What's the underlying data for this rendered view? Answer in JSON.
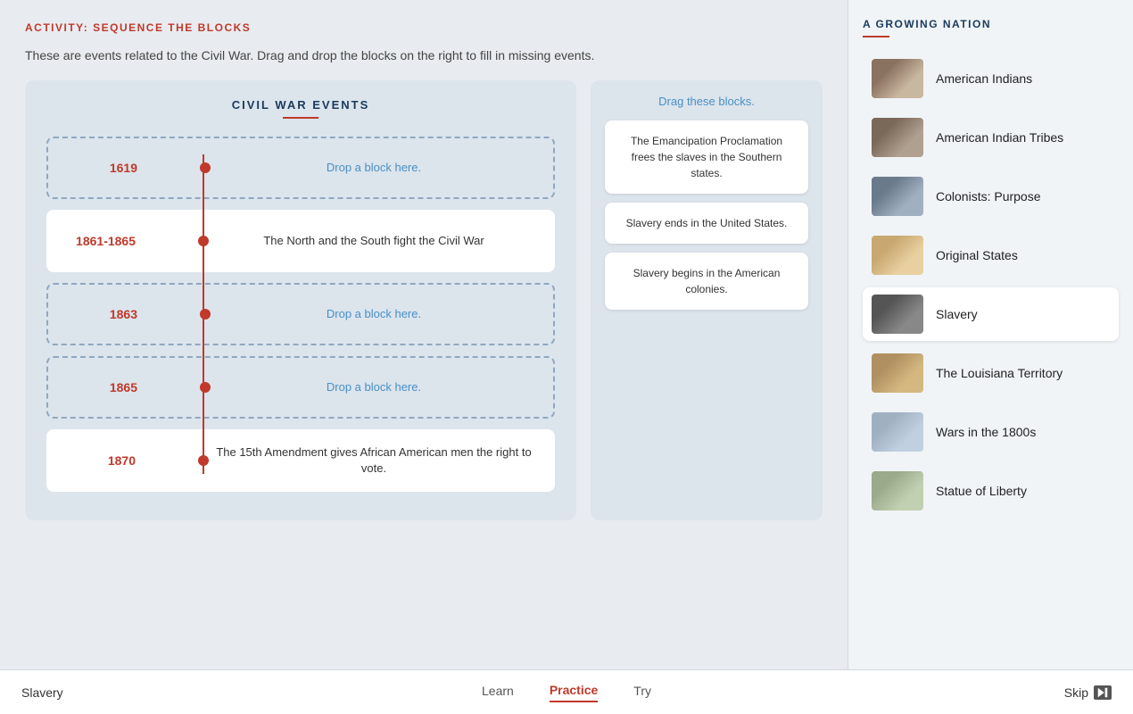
{
  "activity": {
    "title": "ACTIVITY: SEQUENCE THE BLOCKS",
    "description": "These are events related to the Civil War. Drag and drop the blocks on the right to fill in missing events."
  },
  "timeline": {
    "title": "CIVIL WAR EVENTS",
    "events": [
      {
        "year": "1619",
        "text": "Drop a block here.",
        "isDrop": true
      },
      {
        "year": "1861-1865",
        "text": "The North and the South fight the Civil War",
        "isDrop": false
      },
      {
        "year": "1863",
        "text": "Drop a block here.",
        "isDrop": true
      },
      {
        "year": "1865",
        "text": "Drop a block here.",
        "isDrop": true
      },
      {
        "year": "1870",
        "text": "The 15th Amendment gives African American men the right to vote.",
        "isDrop": false
      }
    ]
  },
  "drag_section": {
    "label": "Drag these blocks.",
    "blocks": [
      "The Emancipation Proclamation frees the slaves in the Southern states.",
      "Slavery ends in the United States.",
      "Slavery begins in the American colonies."
    ]
  },
  "sidebar": {
    "title": "A GROWING NATION",
    "items": [
      {
        "label": "American Indians",
        "thumb_class": "thumb-american-indians",
        "active": false
      },
      {
        "label": "American Indian Tribes",
        "thumb_class": "thumb-american-indian-tribes",
        "active": false
      },
      {
        "label": "Colonists: Purpose",
        "thumb_class": "thumb-colonists",
        "active": false
      },
      {
        "label": "Original States",
        "thumb_class": "thumb-original-states",
        "active": false
      },
      {
        "label": "Slavery",
        "thumb_class": "thumb-slavery",
        "active": true
      },
      {
        "label": "The Louisiana Territory",
        "thumb_class": "thumb-louisiana",
        "active": false
      },
      {
        "label": "Wars in the 1800s",
        "thumb_class": "thumb-wars",
        "active": false
      },
      {
        "label": "Statue of Liberty",
        "thumb_class": "thumb-statue",
        "active": false
      }
    ]
  },
  "bottom_bar": {
    "topic": "Slavery",
    "tabs": [
      {
        "label": "Learn",
        "active": false
      },
      {
        "label": "Practice",
        "active": true
      },
      {
        "label": "Try",
        "active": false
      }
    ],
    "skip_label": "Skip"
  }
}
